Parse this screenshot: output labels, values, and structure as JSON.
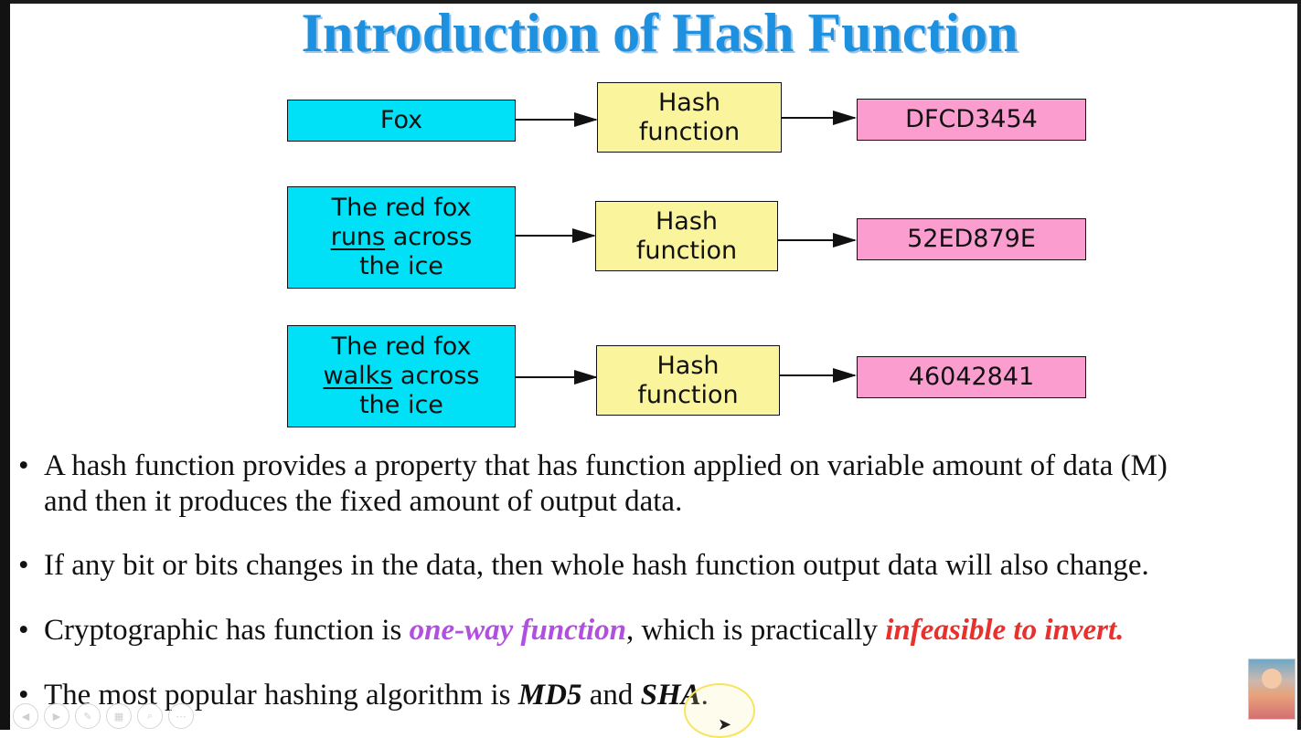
{
  "slide": {
    "title": "Introduction of Hash Function"
  },
  "diagram": {
    "rows": [
      {
        "input_lines": [
          "Fox"
        ],
        "hash_lines": [
          "Hash",
          "function"
        ],
        "output": "DFCD3454"
      },
      {
        "input_lines": [
          "The red fox",
          "runs across",
          "the ice"
        ],
        "input_underlined_word": "runs",
        "hash_lines": [
          "Hash",
          "function"
        ],
        "output": "52ED879E"
      },
      {
        "input_lines": [
          "The red fox",
          "walks across",
          "the ice"
        ],
        "input_underlined_word": "walks",
        "hash_lines": [
          "Hash",
          "function"
        ],
        "output": "46042841"
      }
    ],
    "colors": {
      "input_fill": "#00e1f8",
      "hash_fill": "#faf59c",
      "output_fill": "#fb9ecf",
      "title": "#1e90e0"
    }
  },
  "bullets": [
    {
      "line1": "A hash function provides a property that has function applied on variable amount of data (M)",
      "line2": "and then it produces the fixed amount of output data."
    },
    {
      "line1": "If any bit or bits changes in the data, then whole hash function output data will also change."
    },
    {
      "prefix": "Cryptographic has function is ",
      "emph1": "one-way function",
      "middle": ", which is practically ",
      "emph2": "infeasible to invert."
    },
    {
      "prefix": "The most popular hashing algorithm is ",
      "emph1": "MD5",
      "middle": " and ",
      "emph2": "SHA",
      "suffix": "."
    }
  ],
  "player_controls": [
    "previous-icon",
    "next-icon",
    "pen-icon",
    "slides-icon",
    "zoom-icon",
    "more-icon"
  ]
}
